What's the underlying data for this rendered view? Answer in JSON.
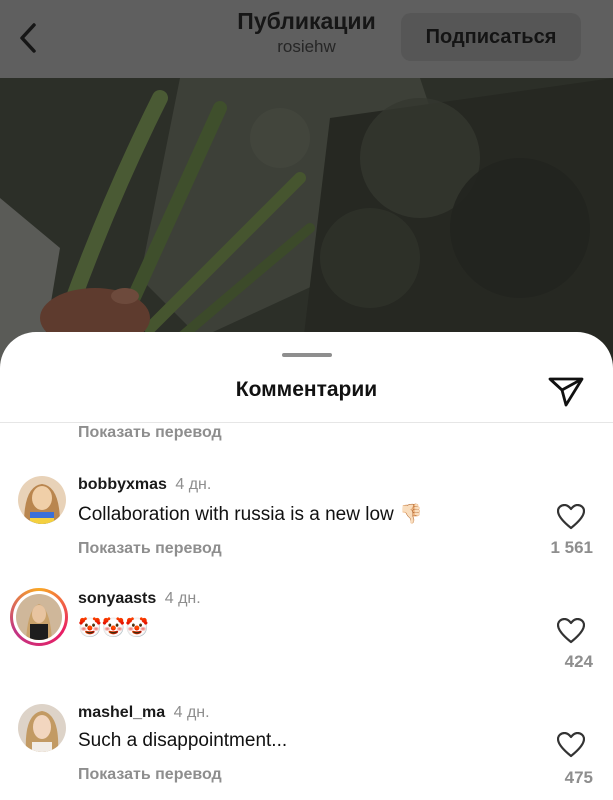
{
  "header": {
    "title": "Публикации",
    "subtitle": "rosiehw",
    "follow_label": "Подписаться"
  },
  "sheet": {
    "title": "Комментарии"
  },
  "top_translate_label": "Показать перевод",
  "comments": [
    {
      "username": "bobbyxmas",
      "time": "4 дн.",
      "text": "Collaboration with russia is a new low 👎🏻",
      "translate_label": "Показать перевод",
      "likes": "1 561"
    },
    {
      "username": "sonyaasts",
      "time": "4 дн.",
      "text": "🤡🤡🤡",
      "likes": "424"
    },
    {
      "username": "mashel_ma",
      "time": "4 дн.",
      "text": "Such a disappointment...",
      "translate_label": "Показать перевод",
      "likes": "475"
    }
  ],
  "colors": {
    "muted_text": "#8e8e8e",
    "dim_overlay": "#5f5f5f",
    "story_ring": "#e91e63"
  },
  "icons": {
    "back": "chevron-left-icon",
    "share": "paper-plane-icon",
    "like": "heart-icon",
    "emoji_clown": "clown-emoji",
    "emoji_thumbs_down": "thumbs-down-emoji"
  }
}
